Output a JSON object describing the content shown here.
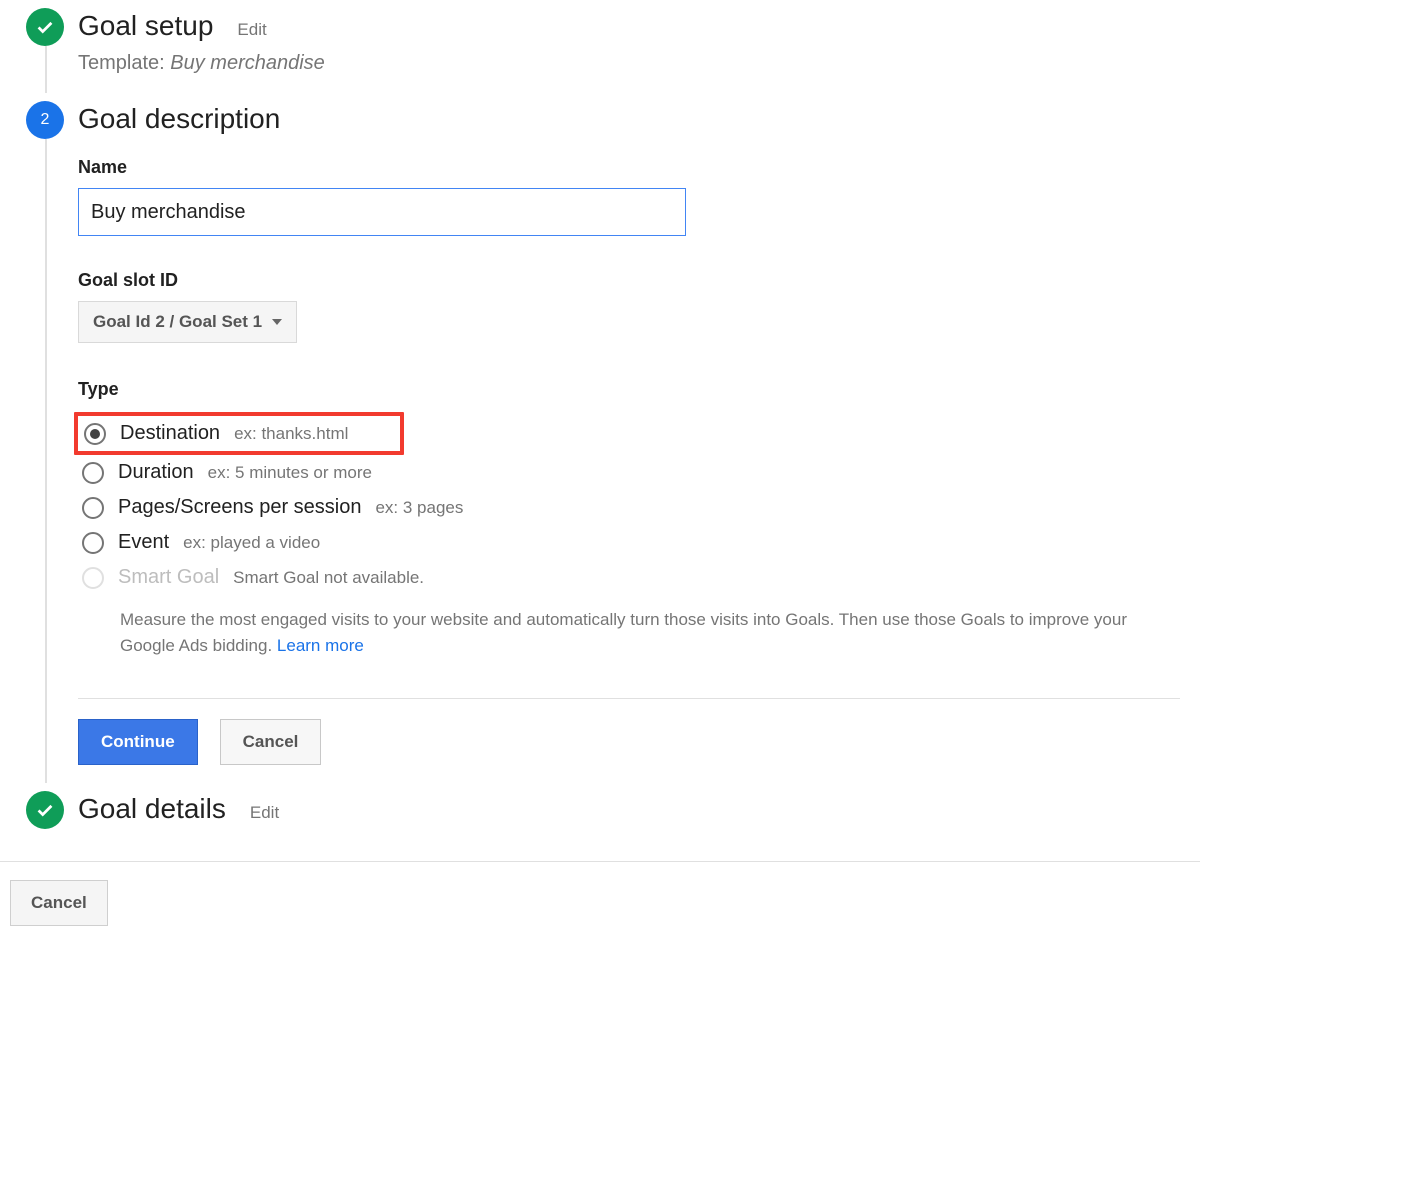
{
  "steps": {
    "setup": {
      "title": "Goal setup",
      "edit": "Edit",
      "templatePrefix": "Template: ",
      "templateName": "Buy merchandise",
      "badge": "check"
    },
    "desc": {
      "title": "Goal description",
      "badge": "2"
    },
    "details": {
      "title": "Goal details",
      "edit": "Edit",
      "badge": "check"
    }
  },
  "form": {
    "nameLabel": "Name",
    "nameValue": "Buy merchandise",
    "slotLabel": "Goal slot ID",
    "slotValue": "Goal Id 2 / Goal Set 1",
    "typeLabel": "Type",
    "types": {
      "destination": {
        "label": "Destination",
        "hint": "ex: thanks.html",
        "selected": true,
        "highlighted": true
      },
      "duration": {
        "label": "Duration",
        "hint": "ex: 5 minutes or more"
      },
      "pages": {
        "label": "Pages/Screens per session",
        "hint": "ex: 3 pages"
      },
      "event": {
        "label": "Event",
        "hint": "ex: played a video"
      },
      "smart": {
        "label": "Smart Goal",
        "hint": "Smart Goal not available.",
        "disabled": true
      }
    },
    "smartDesc": "Measure the most engaged visits to your website and automatically turn those visits into Goals. Then use those Goals to improve your Google Ads bidding. ",
    "learnMore": "Learn more",
    "continue": "Continue",
    "cancel": "Cancel"
  },
  "footer": {
    "cancel": "Cancel"
  }
}
